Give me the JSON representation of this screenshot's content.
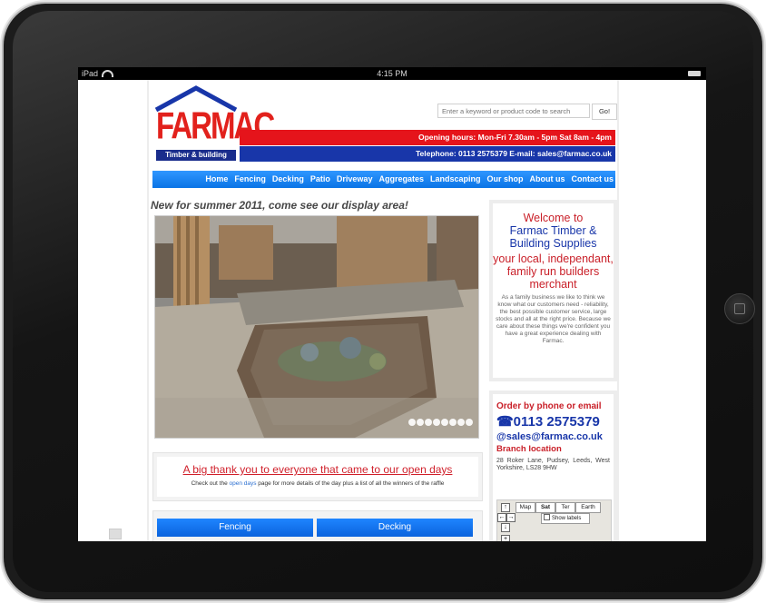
{
  "statusbar": {
    "device": "iPad",
    "time": "4:15 PM"
  },
  "logo": {
    "brand": "FARMAC",
    "tagline": "Timber & building supplies"
  },
  "search": {
    "placeholder": "Enter a keyword or product code to search",
    "button": "Go!"
  },
  "info": {
    "hours": "Opening hours: Mon-Fri 7.30am - 5pm Sat 8am - 4pm",
    "contact": "Telephone: 0113 2575379 E-mail: sales@farmac.co.uk"
  },
  "nav": [
    "Home",
    "Fencing",
    "Decking",
    "Patio",
    "Driveway",
    "Aggregates",
    "Landscaping",
    "Our shop",
    "About us",
    "Contact us"
  ],
  "headline": "New for summer 2011, come see our display area!",
  "slideshow": {
    "dot_count": 8
  },
  "thanks": {
    "title": "A big thank you to everyone that came to our open days",
    "sub_pre": "Check out the ",
    "sub_link": "open days",
    "sub_post": " page for more details of the day plus a list of all the winners of the raffle"
  },
  "categories": [
    "Fencing",
    "Decking"
  ],
  "welcome": {
    "line1": "Welcome to",
    "line2": "Farmac Timber & Building Supplies",
    "line3": "your local, independant, family run builders merchant",
    "body": "As a family business we like to think we know what our customers need - reliability, the best possible customer service, large stocks and all at the right price. Because we care about these things we're confident you have a great experience dealing with Farmac."
  },
  "order": {
    "heading": "Order by phone or email",
    "phone": "☎0113 2575379",
    "email": "@sales@farmac.co.uk",
    "branch_heading": "Branch location",
    "address": "28 Roker Lane, Pudsey, Leeds, West Yorkshire, LS28 9HW"
  },
  "map": {
    "types": [
      "Map",
      "Sat",
      "Ter",
      "Earth"
    ],
    "show_labels": "Show labels"
  },
  "colors": {
    "red": "#e5141b",
    "blue": "#1836a9",
    "nav_blue": "#0a74e6"
  }
}
